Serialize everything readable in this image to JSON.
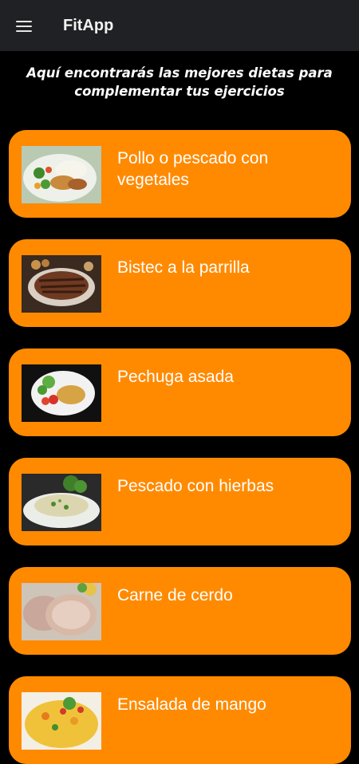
{
  "app": {
    "title": "FitApp",
    "menu_icon": "hamburger-menu-icon"
  },
  "subtitle": "Aquí encontrarás las mejores dietas para complementar tus ejercicios",
  "colors": {
    "card": "#ff8a00",
    "background": "#000000",
    "appbar": "#202124"
  },
  "diets": [
    {
      "label": "Pollo o pescado con vegetales",
      "image": "chicken-vegetables-dish"
    },
    {
      "label": "Bistec a la parrilla",
      "image": "grilled-steak-dish"
    },
    {
      "label": "Pechuga asada",
      "image": "roasted-chicken-breast-dish"
    },
    {
      "label": "Pescado con hierbas",
      "image": "herbed-fish-dish"
    },
    {
      "label": "Carne de cerdo",
      "image": "pork-meat-dish"
    },
    {
      "label": "Ensalada de mango",
      "image": "mango-salad-dish"
    }
  ]
}
